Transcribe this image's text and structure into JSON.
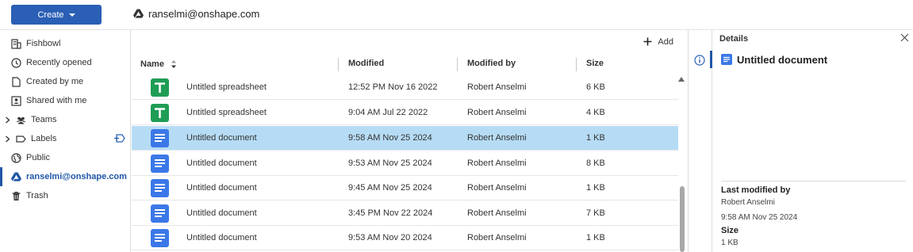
{
  "topbar": {
    "create_label": "Create",
    "breadcrumb_label": "ranselmi@onshape.com"
  },
  "sidebar": {
    "items": [
      {
        "label": "Fishbowl",
        "icon": "building-icon"
      },
      {
        "label": "Recently opened",
        "icon": "clock-icon"
      },
      {
        "label": "Created by me",
        "icon": "document-icon"
      },
      {
        "label": "Shared with me",
        "icon": "shared-person-icon"
      },
      {
        "label": "Teams",
        "icon": "team-icon"
      },
      {
        "label": "Labels",
        "icon": "label-icon"
      },
      {
        "label": "Public",
        "icon": "globe-icon"
      },
      {
        "label": "ranselmi@onshape.com",
        "icon": "drive-icon"
      },
      {
        "label": "Trash",
        "icon": "trash-icon"
      }
    ]
  },
  "main": {
    "add_label": "Add",
    "columns": [
      "Name",
      "Modified",
      "Modified by",
      "Size"
    ],
    "rows": [
      {
        "name": "Untitled spreadsheet",
        "modified": "12:52 PM Nov 16 2022",
        "modified_by": "Robert Anselmi",
        "size": "6 KB",
        "type": "spreadsheet"
      },
      {
        "name": "Untitled spreadsheet",
        "modified": "9:04 AM Jul 22 2022",
        "modified_by": "Robert Anselmi",
        "size": "4 KB",
        "type": "spreadsheet"
      },
      {
        "name": "Untitled document",
        "modified": "9:58 AM Nov 25 2024",
        "modified_by": "Robert Anselmi",
        "size": "1 KB",
        "type": "document"
      },
      {
        "name": "Untitled document",
        "modified": "9:53 AM Nov 25 2024",
        "modified_by": "Robert Anselmi",
        "size": "8 KB",
        "type": "document"
      },
      {
        "name": "Untitled document",
        "modified": "9:45 AM Nov 25 2024",
        "modified_by": "Robert Anselmi",
        "size": "1 KB",
        "type": "document"
      },
      {
        "name": "Untitled document",
        "modified": "3:45 PM Nov 22 2024",
        "modified_by": "Robert Anselmi",
        "size": "7 KB",
        "type": "document"
      },
      {
        "name": "Untitled document",
        "modified": "9:53 AM Nov 20 2024",
        "modified_by": "Robert Anselmi",
        "size": "1 KB",
        "type": "document"
      }
    ]
  },
  "details": {
    "title": "Details",
    "doc_title": "Untitled document",
    "last_modified_label": "Last modified by",
    "last_modified_by": "Robert Anselmi",
    "last_modified_date": "9:58 AM Nov 25 2024",
    "size_label": "Size",
    "size_value": "1 KB"
  },
  "colors": {
    "accent": "#2a5fb5",
    "active_nav": "#1f57a7",
    "selected_row": "#b6dcf5",
    "spreadsheet_icon": "#1f9d55",
    "document_icon": "#3b78e7"
  }
}
